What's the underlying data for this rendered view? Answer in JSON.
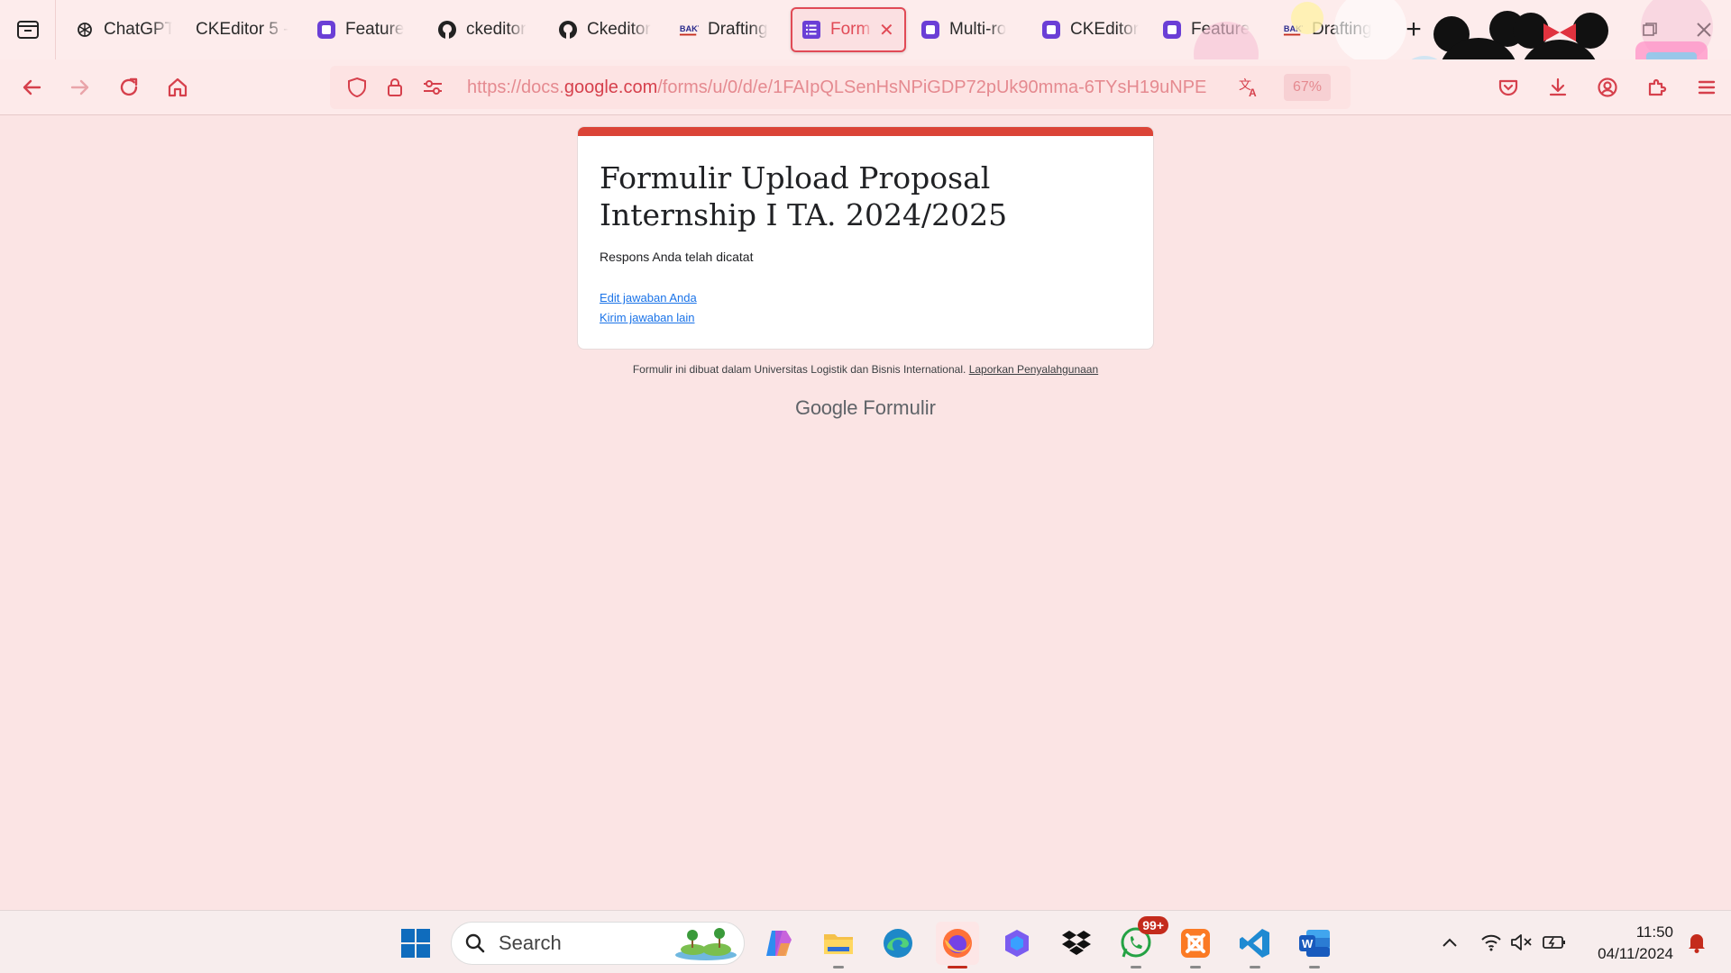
{
  "browser": {
    "tabs": [
      {
        "label": "ChatGPT",
        "icon": "openai-icon"
      },
      {
        "label": "CKEditor 5 -",
        "icon": "none"
      },
      {
        "label": "Feature",
        "icon": "ckeditor-icon"
      },
      {
        "label": "ckeditor",
        "icon": "github-icon"
      },
      {
        "label": "Ckeditor",
        "icon": "github-icon"
      },
      {
        "label": "Drafting",
        "icon": "bakti-icon"
      },
      {
        "label": "Form",
        "icon": "google-forms-icon",
        "active": true
      },
      {
        "label": "Multi-ro",
        "icon": "ckeditor-icon"
      },
      {
        "label": "CKEditor",
        "icon": "ckeditor-icon"
      },
      {
        "label": "Feature",
        "icon": "ckeditor-icon"
      },
      {
        "label": "Drafting",
        "icon": "bakti-icon"
      }
    ],
    "bakti_logo_text": "BAKTI",
    "url_prefix": "https://docs.",
    "url_host": "google.com",
    "url_path": "/forms/u/0/d/e/1FAIpQLSenHsNPiGDP72pUk90mma-6TYsH19uNPE",
    "zoom": "67%",
    "theme_color": "#e14a56"
  },
  "form": {
    "title": "Formulir Upload Proposal Internship I TA. 2024/2025",
    "message": "Respons Anda telah dicatat",
    "edit_link": "Edit jawaban Anda",
    "another_link": "Kirim jawaban lain",
    "footer_text": "Formulir ini dibuat dalam Universitas Logistik dan Bisnis International.",
    "report_link": "Laporkan Penyalahgunaan",
    "brand_google": "Google",
    "brand_forms": "Formulir",
    "accent_color": "#db4437"
  },
  "taskbar": {
    "search_placeholder": "Search",
    "whatsapp_badge": "99+",
    "time": "11:50",
    "date": "04/11/2024"
  }
}
